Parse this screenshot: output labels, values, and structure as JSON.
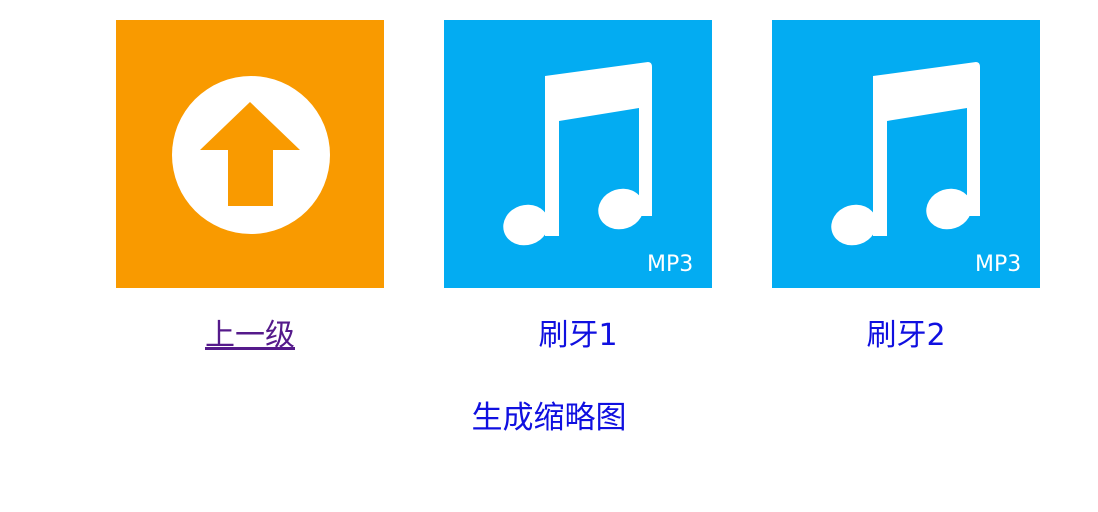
{
  "items": [
    {
      "label": "上一级",
      "icon": "up-arrow-icon",
      "bg": "#f99a00",
      "visited": true
    },
    {
      "label": "刷牙1",
      "icon": "music-note-icon",
      "bg": "#03acf2",
      "badge": "MP3",
      "visited": false
    },
    {
      "label": "刷牙2",
      "icon": "music-note-icon",
      "bg": "#03acf2",
      "badge": "MP3",
      "visited": false
    }
  ],
  "thumbnail_link": "生成缩略图",
  "colors": {
    "link": "#1010e0",
    "visited": "#551a8b",
    "orange": "#f99a00",
    "blue": "#03acf2"
  }
}
